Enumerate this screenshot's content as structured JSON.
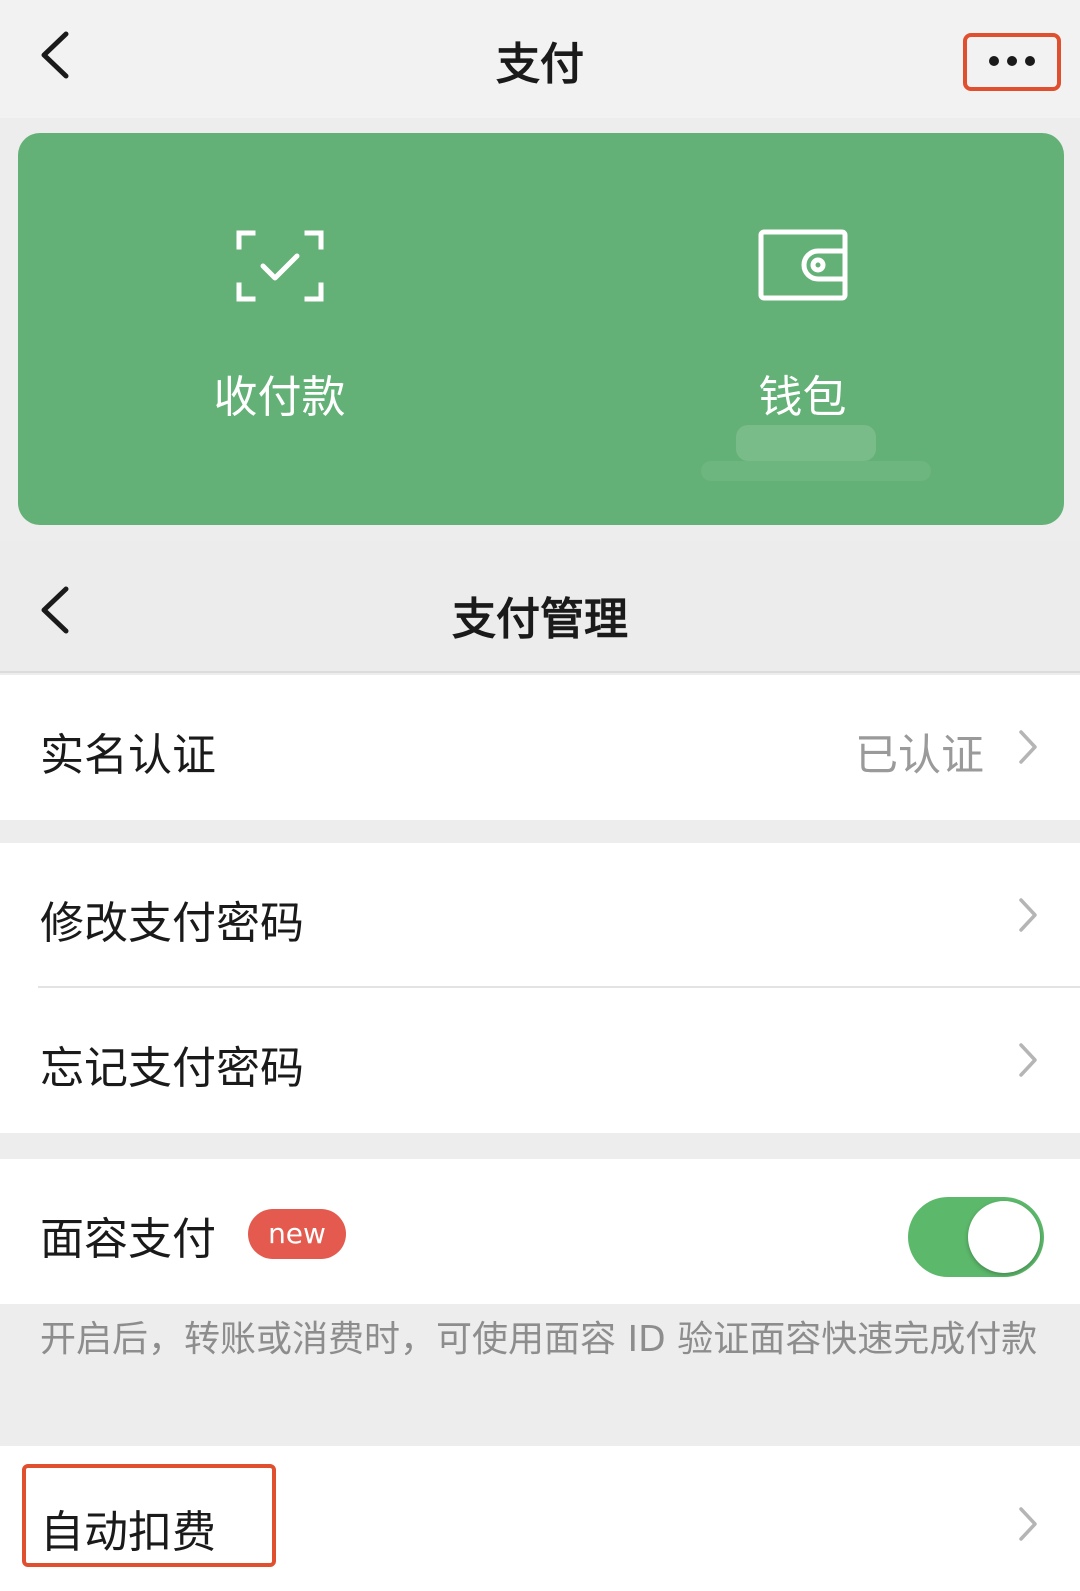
{
  "top_nav": {
    "title": "支付"
  },
  "card": {
    "accent": "#63b176",
    "items": [
      {
        "label": "收付款",
        "icon": "scan-check-icon"
      },
      {
        "label": "钱包",
        "icon": "wallet-icon"
      }
    ]
  },
  "sub_nav": {
    "title": "支付管理"
  },
  "rows": {
    "real_name": {
      "label": "实名认证",
      "value": "已认证"
    },
    "change_pwd": {
      "label": "修改支付密码"
    },
    "forgot_pwd": {
      "label": "忘记支付密码"
    },
    "face_pay": {
      "label": "面容支付",
      "badge": "new",
      "toggle": "on"
    },
    "auto_deduct": {
      "label": "自动扣费"
    }
  },
  "face_pay_desc": "开启后，转账或消费时，可使用面容 ID 验证面容快速完成付款",
  "highlight_color": "#e0502f"
}
